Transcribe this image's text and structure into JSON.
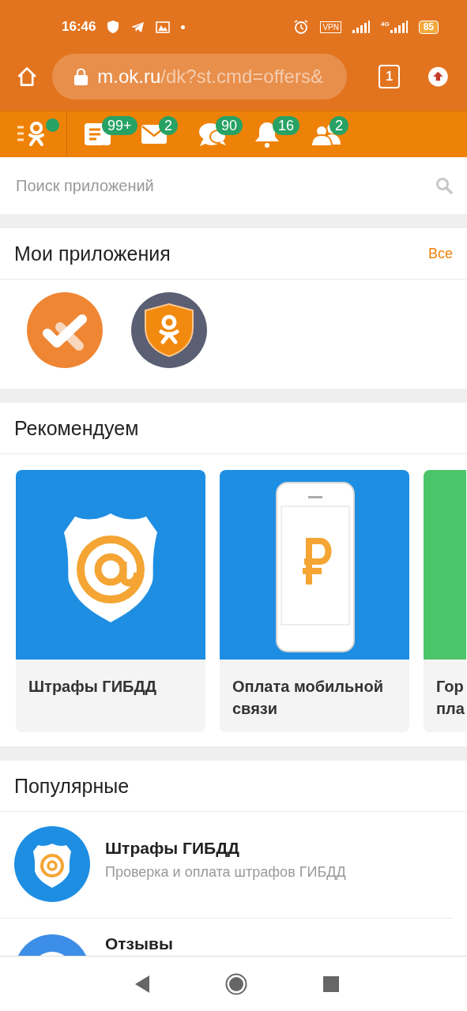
{
  "status_bar": {
    "time": "16:46",
    "vpn": "VPN",
    "network": "4G",
    "battery": "85"
  },
  "browser": {
    "url_host": "m.ok.ru",
    "url_path": "/dk?st.cmd=offers&",
    "tab_count": "1"
  },
  "nav": {
    "menu_dot": true,
    "items": [
      {
        "kind": "feed",
        "badge": "99+"
      },
      {
        "kind": "messages",
        "badge": "2"
      },
      {
        "kind": "discussions",
        "badge": "90"
      },
      {
        "kind": "notifications",
        "badge": "16"
      },
      {
        "kind": "friends",
        "badge": "2"
      }
    ]
  },
  "search": {
    "placeholder": "Поиск приложений"
  },
  "my_apps": {
    "title": "Мои приложения",
    "link": "Все",
    "apps": [
      {
        "kind": "tasks"
      },
      {
        "kind": "shield"
      }
    ]
  },
  "recommended": {
    "title": "Рекомендуем",
    "cards": [
      {
        "kind": "fines",
        "title": "Штрафы ГИБДД"
      },
      {
        "kind": "mobile",
        "title": "Оплата мобильной связи"
      },
      {
        "kind": "green",
        "title": "Гор пла"
      }
    ]
  },
  "popular": {
    "title": "Популярные",
    "items": [
      {
        "kind": "fines",
        "title": "Штрафы ГИБДД",
        "subtitle": "Проверка и оплата штрафов ГИБДД"
      },
      {
        "kind": "reviews",
        "title": "Отзывы"
      }
    ]
  }
}
